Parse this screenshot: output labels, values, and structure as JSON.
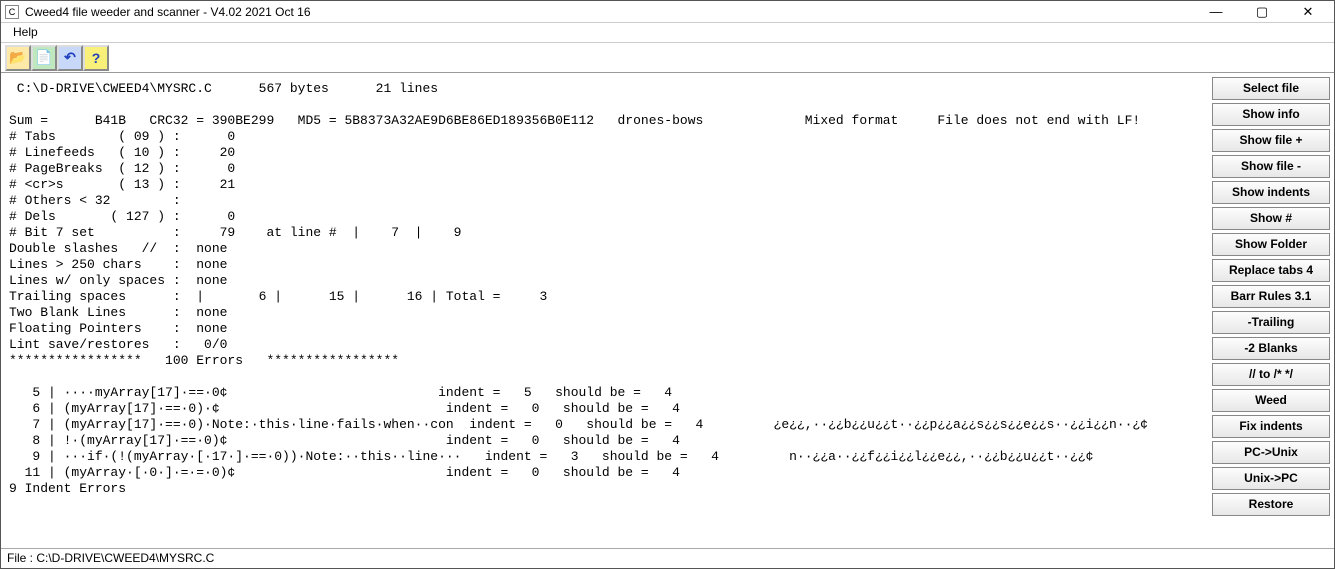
{
  "window": {
    "title": "Cweed4 file weeder and scanner - V4.02 2021 Oct 16"
  },
  "menu": {
    "help": "Help"
  },
  "toolbar": {
    "open": "📂",
    "scan": "📄",
    "undo": "↶",
    "help": "?"
  },
  "sidebar": {
    "buttons": [
      "Select file",
      "Show info",
      "Show file +",
      "Show file -",
      "Show indents",
      "Show #",
      "Show Folder",
      "Replace tabs 4",
      "Barr Rules 3.1",
      "-Trailing",
      "-2 Blanks",
      "// to /* */",
      "Weed",
      "Fix indents",
      "PC->Unix",
      "Unix->PC",
      "Restore"
    ]
  },
  "content": {
    "text": " C:\\D-DRIVE\\CWEED4\\MYSRC.C      567 bytes      21 lines\n\nSum =      B41B   CRC32 = 390BE299   MD5 = 5B8373A32AE9D6BE86ED189356B0E112   drones-bows             Mixed format     File does not end with LF!\n# Tabs        ( 09 ) :      0\n# Linefeeds   ( 10 ) :     20\n# PageBreaks  ( 12 ) :      0\n# <cr>s       ( 13 ) :     21\n# Others < 32        :\n# Dels       ( 127 ) :      0\n# Bit 7 set          :     79    at line #  |    7  |    9\nDouble slashes   //  :  none\nLines > 250 chars    :  none\nLines w/ only spaces :  none\nTrailing spaces      :  |       6 |      15 |      16 | Total =     3\nTwo Blank Lines      :  none\nFloating Pointers    :  none\nLint save/restores   :   0/0\n*****************   100 Errors   *****************\n\n   5 | ····myArray[17]·==·0¢                           indent =   5   should be =   4\n   6 | (myArray[17]·==·0)·¢                             indent =   0   should be =   4\n   7 | (myArray[17]·==·0)·Note:·this·line·fails·when··con  indent =   0   should be =   4         ¿e¿¿,··¿¿b¿¿u¿¿t··¿¿p¿¿a¿¿s¿¿s¿¿e¿¿s··¿¿i¿¿n··¿¢\n   8 | !·(myArray[17]·==·0)¢                            indent =   0   should be =   4\n   9 | ···if·(!(myArray·[·17·]·==·0))·Note:··this··line···   indent =   3   should be =   4         n··¿¿a··¿¿f¿¿i¿¿l¿¿e¿¿,··¿¿b¿¿u¿¿t··¿¿¢\n  11 | (myArray·[·0·]·=·=·0)¢                           indent =   0   should be =   4\n9 Indent Errors"
  },
  "statusbar": {
    "text": "File : C:\\D-DRIVE\\CWEED4\\MYSRC.C"
  }
}
